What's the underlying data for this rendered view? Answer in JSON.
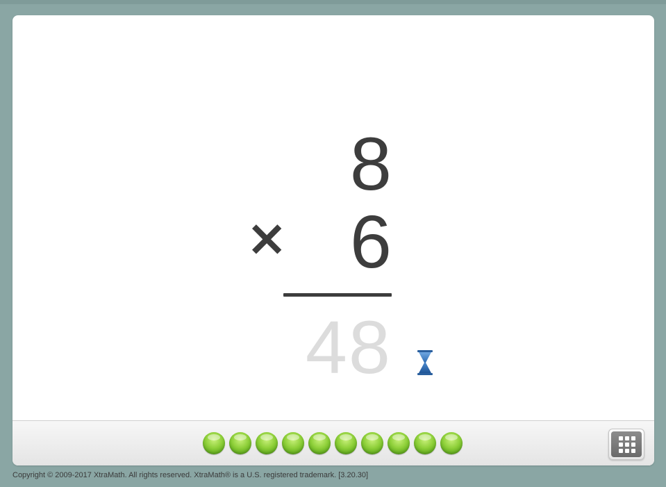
{
  "problem": {
    "top_operand": "8",
    "operator_symbol": "×",
    "bottom_operand": "6",
    "answer_hint": "48"
  },
  "status": {
    "timer_icon": "hourglass-icon",
    "timer_color": "#2f6db3"
  },
  "progress": {
    "completed_count": 10,
    "total_count": 10,
    "dot_color": "#7ec42e"
  },
  "toolbar": {
    "keypad_icon": "keypad-icon"
  },
  "footer": {
    "copyright": "Copyright © 2009-2017 XtraMath. All rights reserved. XtraMath® is a U.S. registered trademark. [3.20.30]"
  },
  "colors": {
    "background": "#8aa6a4",
    "text": "#3d3d3d",
    "answer_hint": "#dcdcdc"
  }
}
